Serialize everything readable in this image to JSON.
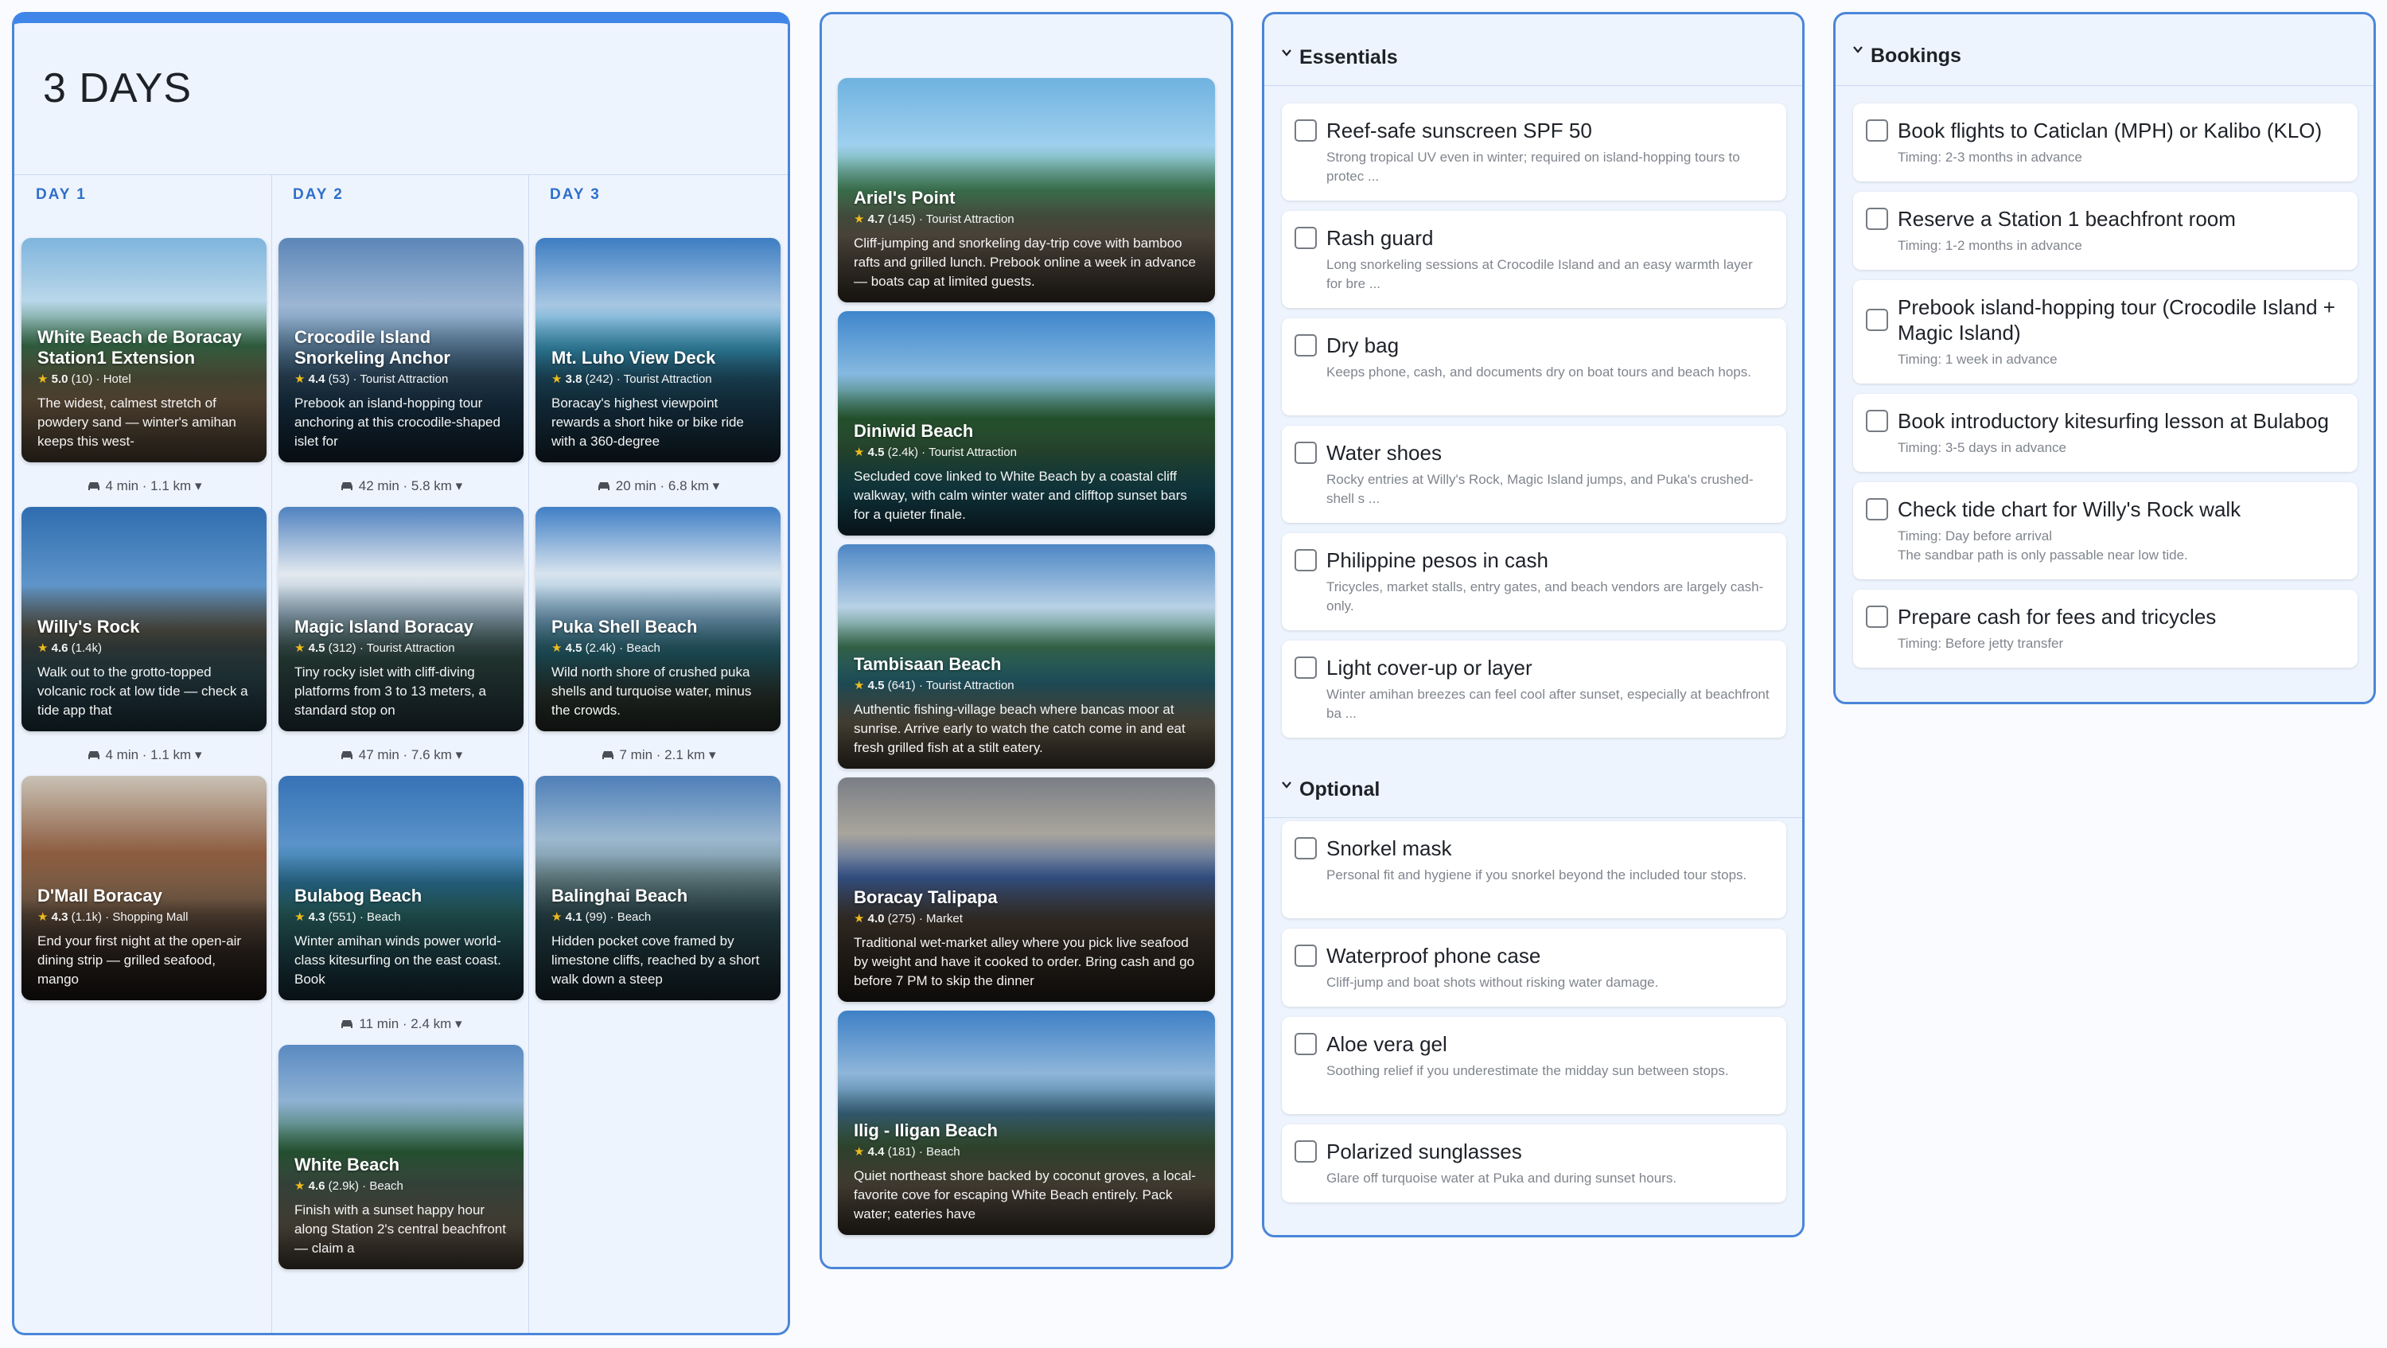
{
  "itinerary": {
    "title": "3 DAYS",
    "days": [
      {
        "label": "DAY 1",
        "cards": [
          {
            "name": "White Beach de Boracay Station1 Extension",
            "rating": "5.0",
            "reviews": "(10)",
            "category": "Hotel",
            "desc": "The widest, calmest stretch of powdery sand — winter's amihan keeps this west-"
          },
          {
            "name": "Willy's Rock",
            "rating": "4.6",
            "reviews": "(1.4k)",
            "category": "",
            "desc": "Walk out to the grotto-topped volcanic rock at low tide — check a tide app that"
          },
          {
            "name": "D'Mall Boracay",
            "rating": "4.3",
            "reviews": "(1.1k)",
            "category": "Shopping Mall",
            "desc": "End your first night at the open-air dining strip — grilled seafood, mango"
          }
        ],
        "travel": [
          "4 min · 1.1 km",
          "4 min · 1.1 km"
        ]
      },
      {
        "label": "DAY 2",
        "cards": [
          {
            "name": "Crocodile Island Snorkeling Anchor",
            "rating": "4.4",
            "reviews": "(53)",
            "category": "Tourist Attraction",
            "desc": "Prebook an island-hopping tour anchoring at this crocodile-shaped islet for"
          },
          {
            "name": "Magic Island Boracay",
            "rating": "4.5",
            "reviews": "(312)",
            "category": "Tourist Attraction",
            "desc": "Tiny rocky islet with cliff-diving platforms from 3 to 13 meters, a standard stop on"
          },
          {
            "name": "Bulabog Beach",
            "rating": "4.3",
            "reviews": "(551)",
            "category": "Beach",
            "desc": "Winter amihan winds power world-class kitesurfing on the east coast. Book"
          },
          {
            "name": "White Beach",
            "rating": "4.6",
            "reviews": "(2.9k)",
            "category": "Beach",
            "desc": "Finish with a sunset happy hour along Station 2's central beachfront — claim a"
          }
        ],
        "travel": [
          "42 min · 5.8 km",
          "47 min · 7.6 km",
          "11 min · 2.4 km"
        ]
      },
      {
        "label": "DAY 3",
        "cards": [
          {
            "name": "Mt. Luho View Deck",
            "rating": "3.8",
            "reviews": "(242)",
            "category": "Tourist Attraction",
            "desc": "Boracay's highest viewpoint rewards a short hike or bike ride with a 360-degree"
          },
          {
            "name": "Puka Shell Beach",
            "rating": "4.5",
            "reviews": "(2.4k)",
            "category": "Beach",
            "desc": "Wild north shore of crushed puka shells and turquoise water, minus the crowds."
          },
          {
            "name": "Balinghai Beach",
            "rating": "4.1",
            "reviews": "(99)",
            "category": "Beach",
            "desc": "Hidden pocket cove framed by limestone cliffs, reached by a short walk down a steep"
          }
        ],
        "travel": [
          "20 min · 6.8 km",
          "7 min · 2.1 km"
        ]
      }
    ]
  },
  "suggestions": [
    {
      "name": "Ariel's Point",
      "rating": "4.7",
      "reviews": "(145)",
      "category": "Tourist Attraction",
      "desc": "Cliff-jumping and snorkeling day-trip cove with bamboo rafts and grilled lunch. Prebook online a week in advance — boats cap at limited guests."
    },
    {
      "name": "Diniwid Beach",
      "rating": "4.5",
      "reviews": "(2.4k)",
      "category": "Tourist Attraction",
      "desc": "Secluded cove linked to White Beach by a coastal cliff walkway, with calm winter water and clifftop sunset bars for a quieter finale."
    },
    {
      "name": "Tambisaan Beach",
      "rating": "4.5",
      "reviews": "(641)",
      "category": "Tourist Attraction",
      "desc": "Authentic fishing-village beach where bancas moor at sunrise. Arrive early to watch the catch come in and eat fresh grilled fish at a stilt eatery."
    },
    {
      "name": "Boracay Talipapa",
      "rating": "4.0",
      "reviews": "(275)",
      "category": "Market",
      "desc": "Traditional wet-market alley where you pick live seafood by weight and have it cooked to order. Bring cash and go before 7 PM to skip the dinner"
    },
    {
      "name": "Ilig - Iligan Beach",
      "rating": "4.4",
      "reviews": "(181)",
      "category": "Beach",
      "desc": "Quiet northeast shore backed by coconut groves, a local-favorite cove for escaping White Beach entirely. Pack water; eateries have"
    }
  ],
  "packing": {
    "essentials_title": "Essentials",
    "essentials": [
      {
        "title": "Reef-safe sunscreen SPF 50",
        "note": "Strong tropical UV even in winter; required on island-hopping tours to protec ..."
      },
      {
        "title": "Rash guard",
        "note": "Long snorkeling sessions at Crocodile Island and an easy warmth layer for bre ..."
      },
      {
        "title": "Dry bag",
        "note": "Keeps phone, cash, and documents dry on boat tours and beach hops."
      },
      {
        "title": "Water shoes",
        "note": "Rocky entries at Willy's Rock, Magic Island jumps, and Puka's crushed-shell s ..."
      },
      {
        "title": "Philippine pesos in cash",
        "note": "Tricycles, market stalls, entry gates, and beach vendors are largely cash-only."
      },
      {
        "title": "Light cover-up or layer",
        "note": "Winter amihan breezes can feel cool after sunset, especially at beachfront ba ..."
      }
    ],
    "optional_title": "Optional",
    "optional": [
      {
        "title": "Snorkel mask",
        "note": "Personal fit and hygiene if you snorkel beyond the included tour stops."
      },
      {
        "title": "Waterproof phone case",
        "note": "Cliff-jump and boat shots without risking water damage."
      },
      {
        "title": "Aloe vera gel",
        "note": "Soothing relief if you underestimate the midday sun between stops."
      },
      {
        "title": "Polarized sunglasses",
        "note": "Glare off turquoise water at Puka and during sunset hours."
      }
    ]
  },
  "bookings": {
    "title": "Bookings",
    "items": [
      {
        "title": "Book flights to Caticlan (MPH) or Kalibo (KLO)",
        "timing": "Timing: 2-3 months in advance"
      },
      {
        "title": "Reserve a Station 1 beachfront room",
        "timing": "Timing: 1-2 months in advance"
      },
      {
        "title": "Prebook island-hopping tour (Crocodile Island + Magic Island)",
        "timing": "Timing: 1 week in advance"
      },
      {
        "title": "Book introductory kitesurfing lesson at Bulabog",
        "timing": "Timing: 3-5 days in advance"
      },
      {
        "title": "Check tide chart for Willy's Rock walk",
        "timing": "Timing: Day before arrival",
        "note": "The sandbar path is only passable near low tide."
      },
      {
        "title": "Prepare cash for fees and tricycles",
        "timing": "Timing: Before jetty transfer"
      }
    ]
  },
  "colors": {
    "accent": "#3f86e8",
    "panel_bg": "#eef4fd",
    "panel_border": "#4a86d9",
    "star": "#f7c21c"
  }
}
